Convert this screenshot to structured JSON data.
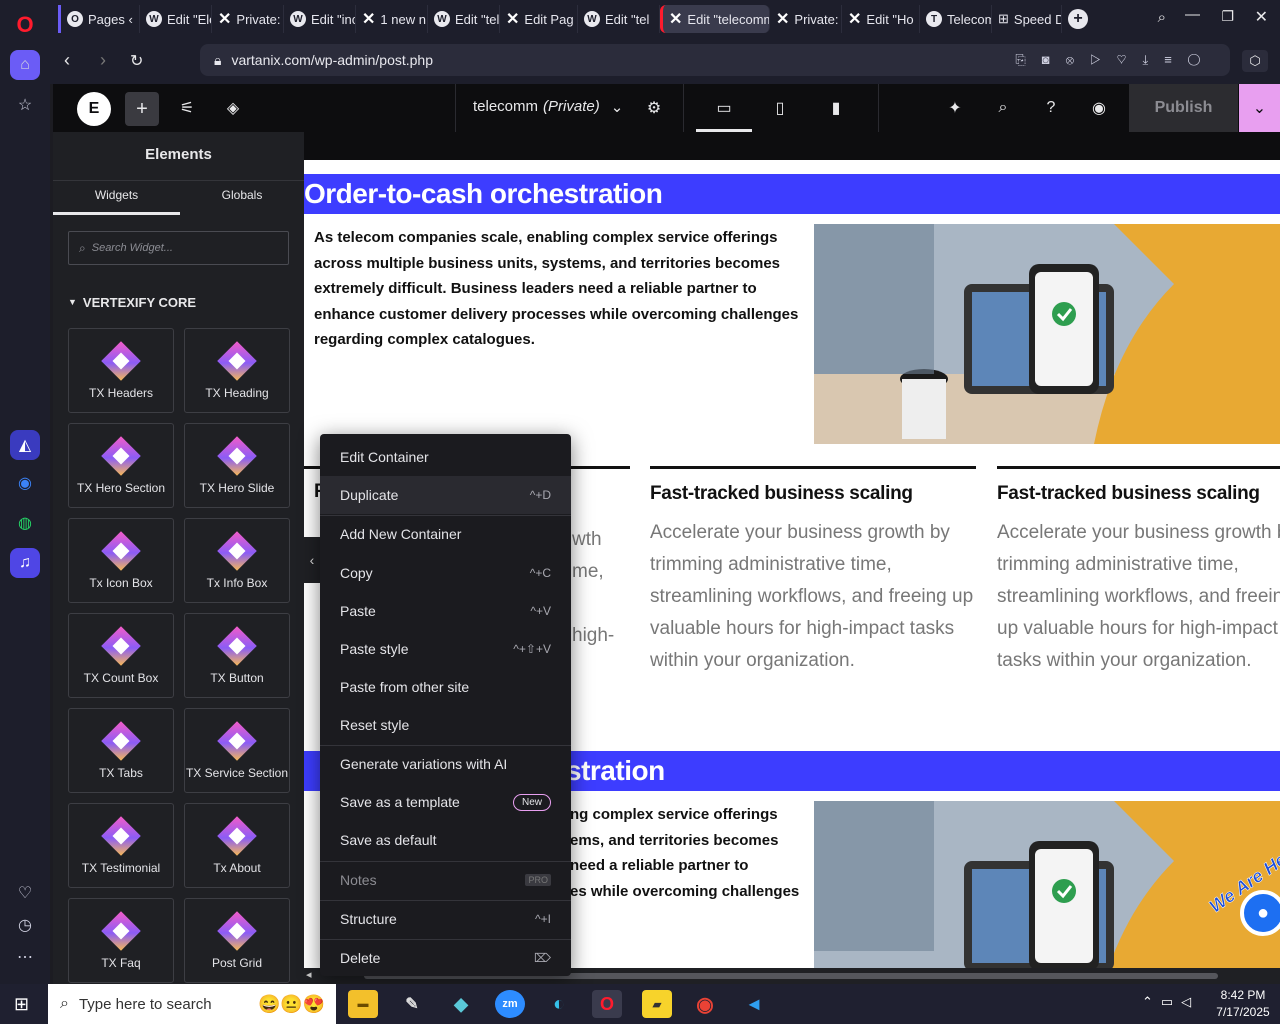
{
  "browser": {
    "tabs": [
      {
        "label": "Pages ‹",
        "icon": "opera-icon"
      },
      {
        "label": "Edit \"Ele",
        "icon": "wordpress-icon"
      },
      {
        "label": "Private:",
        "icon": "elementor-x-icon"
      },
      {
        "label": "Edit \"inc",
        "icon": "wordpress-icon"
      },
      {
        "label": "1 new n",
        "icon": "elementor-x-icon"
      },
      {
        "label": "Edit \"tel",
        "icon": "wordpress-icon"
      },
      {
        "label": "Edit Pag",
        "icon": "elementor-x-icon"
      },
      {
        "label": "Edit \"tel",
        "icon": "wordpress-icon"
      },
      {
        "label": "Edit \"telecomm",
        "icon": "elementor-x-icon"
      },
      {
        "label": "Private:",
        "icon": "elementor-x-icon"
      },
      {
        "label": "Edit \"Ho",
        "icon": "elementor-x-icon"
      },
      {
        "label": "Telecom",
        "icon": "telecom-icon"
      },
      {
        "label": "Speed D",
        "icon": "speed-dial-icon"
      }
    ],
    "url": "vartanix.com/wp-admin/post.php"
  },
  "editor": {
    "page_name": "telecomm",
    "page_status": "(Private)",
    "publish_label": "Publish",
    "panel_title": "Elements",
    "tabs": [
      "Widgets",
      "Globals"
    ],
    "search_placeholder": "Search Widget...",
    "category": "VERTEXIFY CORE",
    "widgets": [
      "TX Headers",
      "TX Heading",
      "TX Hero Section",
      "TX Hero Slide",
      "Tx Icon Box",
      "Tx Info Box",
      "TX Count Box",
      "TX Button",
      "TX Tabs",
      "TX Service Section",
      "TX Testimonial",
      "Tx About",
      "TX Faq",
      "Post Grid"
    ]
  },
  "page": {
    "band_title": "Order-to-cash orchestration",
    "band_title_partial": "stration",
    "intro": "As telecom companies scale, enabling complex service offerings across multiple business units, systems, and territories becomes extremely difficult. Business leaders need a reliable partner to enhance customer delivery processes while overcoming challenges regarding complex catalogues.",
    "intro2_lines": [
      "ng complex service offerings",
      "ems, and territories becomes",
      "need a reliable partner to",
      "es while overcoming challenges"
    ],
    "col1_partial": [
      "F",
      "wth",
      "me,",
      "high-"
    ],
    "columns": [
      {
        "title": "Fast-tracked business scaling",
        "body": "Accelerate your business growth by trimming administrative time, streamlining workflows, and freeing up valuable hours for high-impact tasks within your organization."
      },
      {
        "title": "Fast-tracked business scaling",
        "body": "Accelerate your business growth by trimming administrative time, streamlining workflows, and freeing up valuable hours for high-impact tasks within your organization."
      }
    ],
    "chat_badge": "We Are Here"
  },
  "context_menu": [
    {
      "label": "Edit Container",
      "shortcut": ""
    },
    {
      "label": "Duplicate",
      "shortcut": "^+D"
    },
    {
      "label": "Add New Container",
      "shortcut": ""
    },
    {
      "label": "Copy",
      "shortcut": "^+C"
    },
    {
      "label": "Paste",
      "shortcut": "^+V"
    },
    {
      "label": "Paste style",
      "shortcut": "^+⇧+V"
    },
    {
      "label": "Paste from other site",
      "shortcut": ""
    },
    {
      "label": "Reset style",
      "shortcut": ""
    },
    {
      "label": "Generate variations with AI",
      "shortcut": ""
    },
    {
      "label": "Save as a template",
      "shortcut": "",
      "badge": "New"
    },
    {
      "label": "Save as default",
      "shortcut": ""
    },
    {
      "label": "Notes",
      "shortcut": "",
      "badge": "PRO"
    },
    {
      "label": "Structure",
      "shortcut": "^+I"
    },
    {
      "label": "Delete",
      "shortcut": "⌦"
    }
  ],
  "taskbar": {
    "search_placeholder": "Type here to search",
    "time": "8:42 PM",
    "date": "7/17/2025"
  },
  "colors": {
    "band": "#3d3dff",
    "publish_toggle": "#e89ff0",
    "opera_red": "#ff1b2d"
  }
}
